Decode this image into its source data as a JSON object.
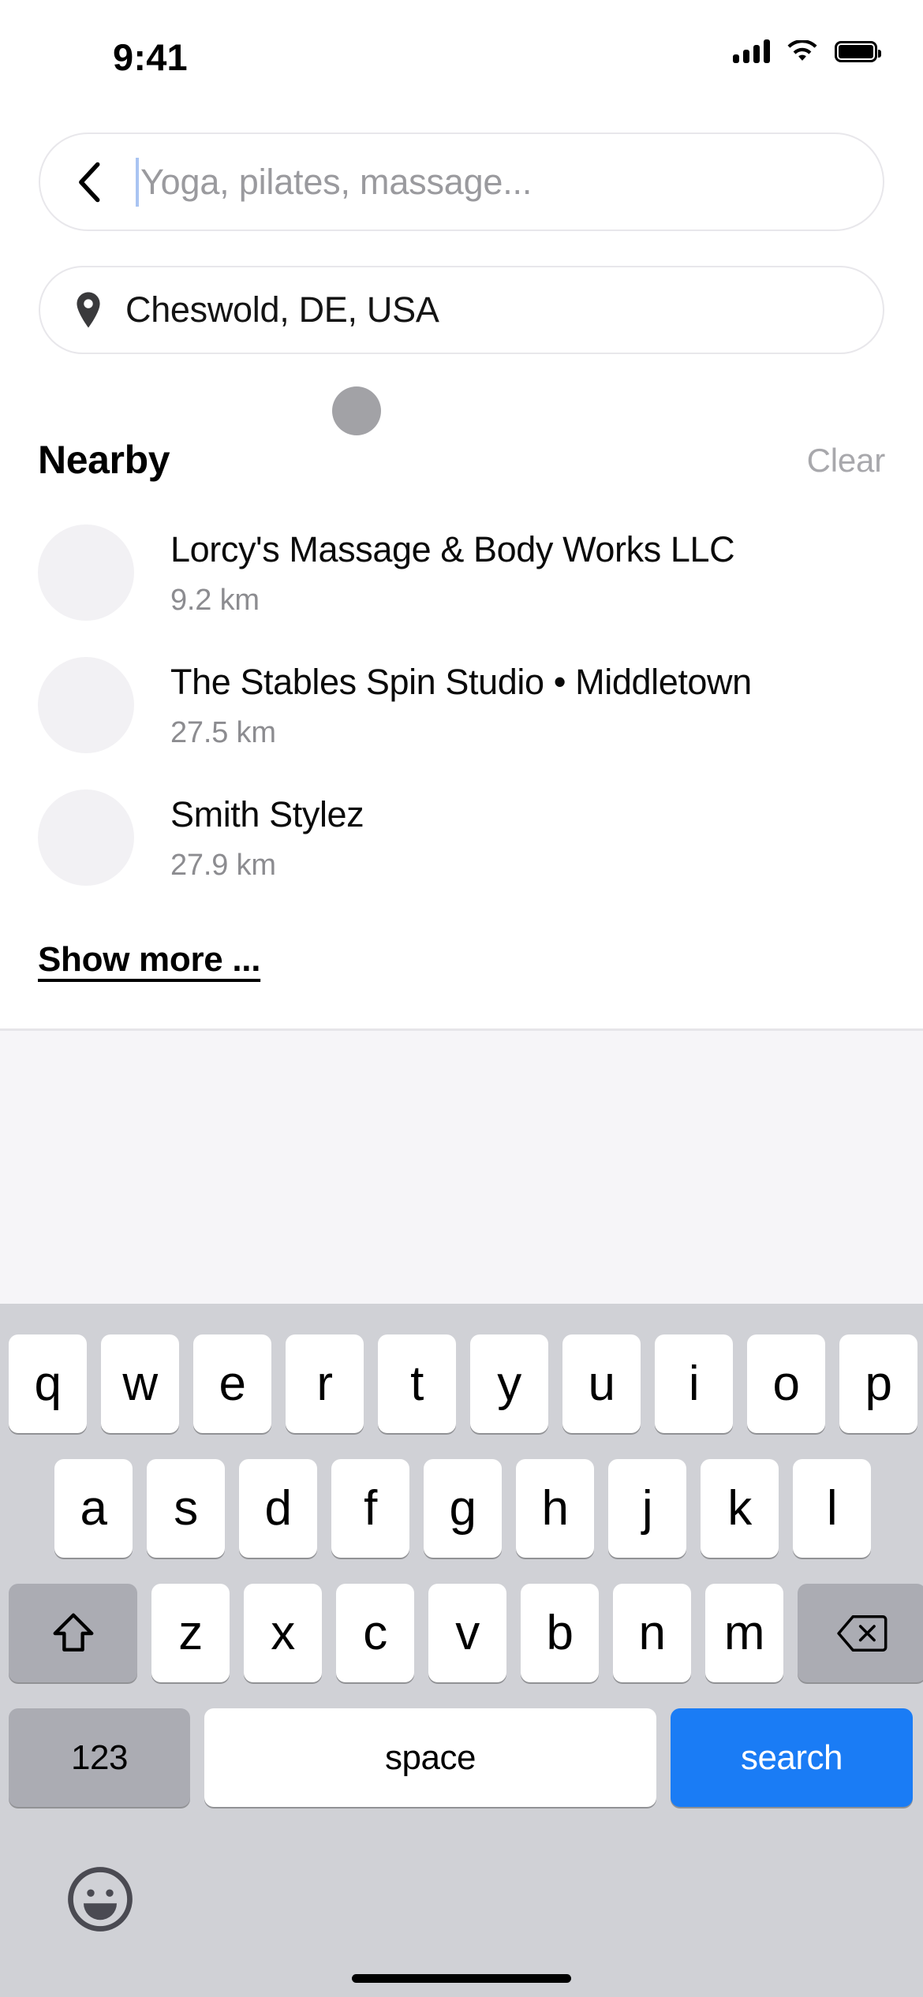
{
  "status_bar": {
    "time": "9:41",
    "signal_icon": "cellular-signal-icon",
    "wifi_icon": "wifi-icon",
    "battery_icon": "battery-full-icon"
  },
  "search": {
    "back_icon": "back-chevron-icon",
    "placeholder": "Yoga, pilates, massage...",
    "value": ""
  },
  "location": {
    "pin_icon": "location-pin-icon",
    "value": "Cheswold, DE, USA"
  },
  "nearby": {
    "title": "Nearby",
    "clear_label": "Clear",
    "items": [
      {
        "name": "Lorcy's Massage & Body Works LLC",
        "distance": "9.2 km"
      },
      {
        "name": "The Stables Spin Studio • Middletown",
        "distance": "27.5 km"
      },
      {
        "name": "Smith Stylez",
        "distance": "27.9 km"
      }
    ],
    "show_more_label": "Show more ..."
  },
  "keyboard": {
    "row1": [
      "q",
      "w",
      "e",
      "r",
      "t",
      "y",
      "u",
      "i",
      "o",
      "p"
    ],
    "row2": [
      "a",
      "s",
      "d",
      "f",
      "g",
      "h",
      "j",
      "k",
      "l"
    ],
    "row3": [
      "z",
      "x",
      "c",
      "v",
      "b",
      "n",
      "m"
    ],
    "shift_icon": "shift-arrow-icon",
    "backspace_icon": "backspace-delete-icon",
    "numbers_label": "123",
    "space_label": "space",
    "search_label": "search",
    "emoji_icon": "emoji-smiley-icon",
    "accent_color": "#1A7CF5",
    "key_bg": "#FFFFFF",
    "modifier_bg": "#ABACB3",
    "keyboard_bg": "#D0D1D6"
  },
  "home_indicator": "home-indicator-bar"
}
